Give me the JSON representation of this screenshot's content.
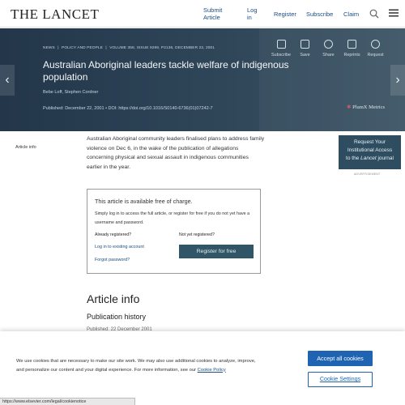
{
  "header": {
    "logo": "THE LANCET",
    "nav": {
      "submit_article": "Submit Article",
      "login": "Log in",
      "register": "Register",
      "subscribe": "Subscribe",
      "claim": "Claim"
    },
    "icons": [
      "search-icon",
      "menu-icon"
    ]
  },
  "hero": {
    "breadcrumb": [
      "NEWS",
      "|",
      "POLICY AND PEOPLE",
      "|",
      "VOLUME 358, ISSUE 9299, P2136, DECEMBER 22, 2001"
    ],
    "title": "Australian Aboriginal leaders tackle welfare of indigenous population",
    "authors": "Bebe Loff, Stephen Cordner",
    "published_label": "Published: December 22, 2001",
    "doi_label": "DOI:",
    "doi": "https://doi.org/10.1016/S0140-6736(01)07242-7",
    "plumx": "PlumX Metrics",
    "actions": [
      {
        "label": "Subscribe",
        "icon": "subscribe-icon"
      },
      {
        "label": "Save",
        "icon": "save-icon"
      },
      {
        "label": "Share",
        "icon": "share-icon"
      },
      {
        "label": "Reprints",
        "icon": "reprints-icon"
      },
      {
        "label": "Request",
        "icon": "request-icon"
      }
    ],
    "bg_color": "#2f4659"
  },
  "sidebar": {
    "article_info": "Article info"
  },
  "lead": "Australian Aboriginal community leaders finalised plans to address family violence on Dec 6, in the wake of the publication of allegations concerning physical and sexual assault in indigenous communities earlier in the year.",
  "ad": {
    "line1": "Request Your",
    "line2": "Institutional Access",
    "line3_pre": "to the ",
    "line3_em": "Lancet",
    "line3_post": " journal",
    "label": "ADVERTISEMENT"
  },
  "free_box": {
    "title": "This article is available free of charge.",
    "desc": "Simply log in to access the full article, or register for free if you do not yet have a username and password.",
    "already": "Already registered?",
    "not_yet": "Not yet registered?",
    "login_link": "Log in to existing account",
    "forgot_link": "Forgot password?",
    "register_btn": "Register for free"
  },
  "article_info": {
    "heading": "Article info",
    "pub_history": "Publication history",
    "pub_date": "Published: 22 December 2001"
  },
  "cookie": {
    "text": "We use cookies that are necessary to make our site work. We may also use additional cookies to analyze, improve, and personalize our content and your digital experience. For more information, see our",
    "link": "Cookie Policy",
    "accept": "Accept all cookies",
    "settings": "Cookie Settings",
    "accent": "#1f64b3"
  },
  "status_url": "https://www.elsevier.com/legal/cookienotice"
}
